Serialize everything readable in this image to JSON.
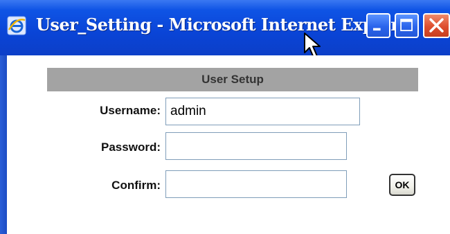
{
  "window": {
    "title": "User_Setting - Microsoft Internet Explorer",
    "icons": {
      "app": "ie-icon",
      "minimize": "minimize-icon",
      "maximize": "maximize-icon",
      "close": "close-icon",
      "cursor": "mouse-cursor-icon"
    }
  },
  "form": {
    "header": "User Setup",
    "username_label": "Username:",
    "username_value": "admin",
    "password_label": "Password:",
    "password_value": "",
    "confirm_label": "Confirm:",
    "confirm_value": "",
    "ok_label": "OK"
  },
  "colors": {
    "titlebar": "#0a44d6",
    "header_bar": "#a3a3a3",
    "close_button": "#de4e2e",
    "field_border": "#7f9db9"
  }
}
